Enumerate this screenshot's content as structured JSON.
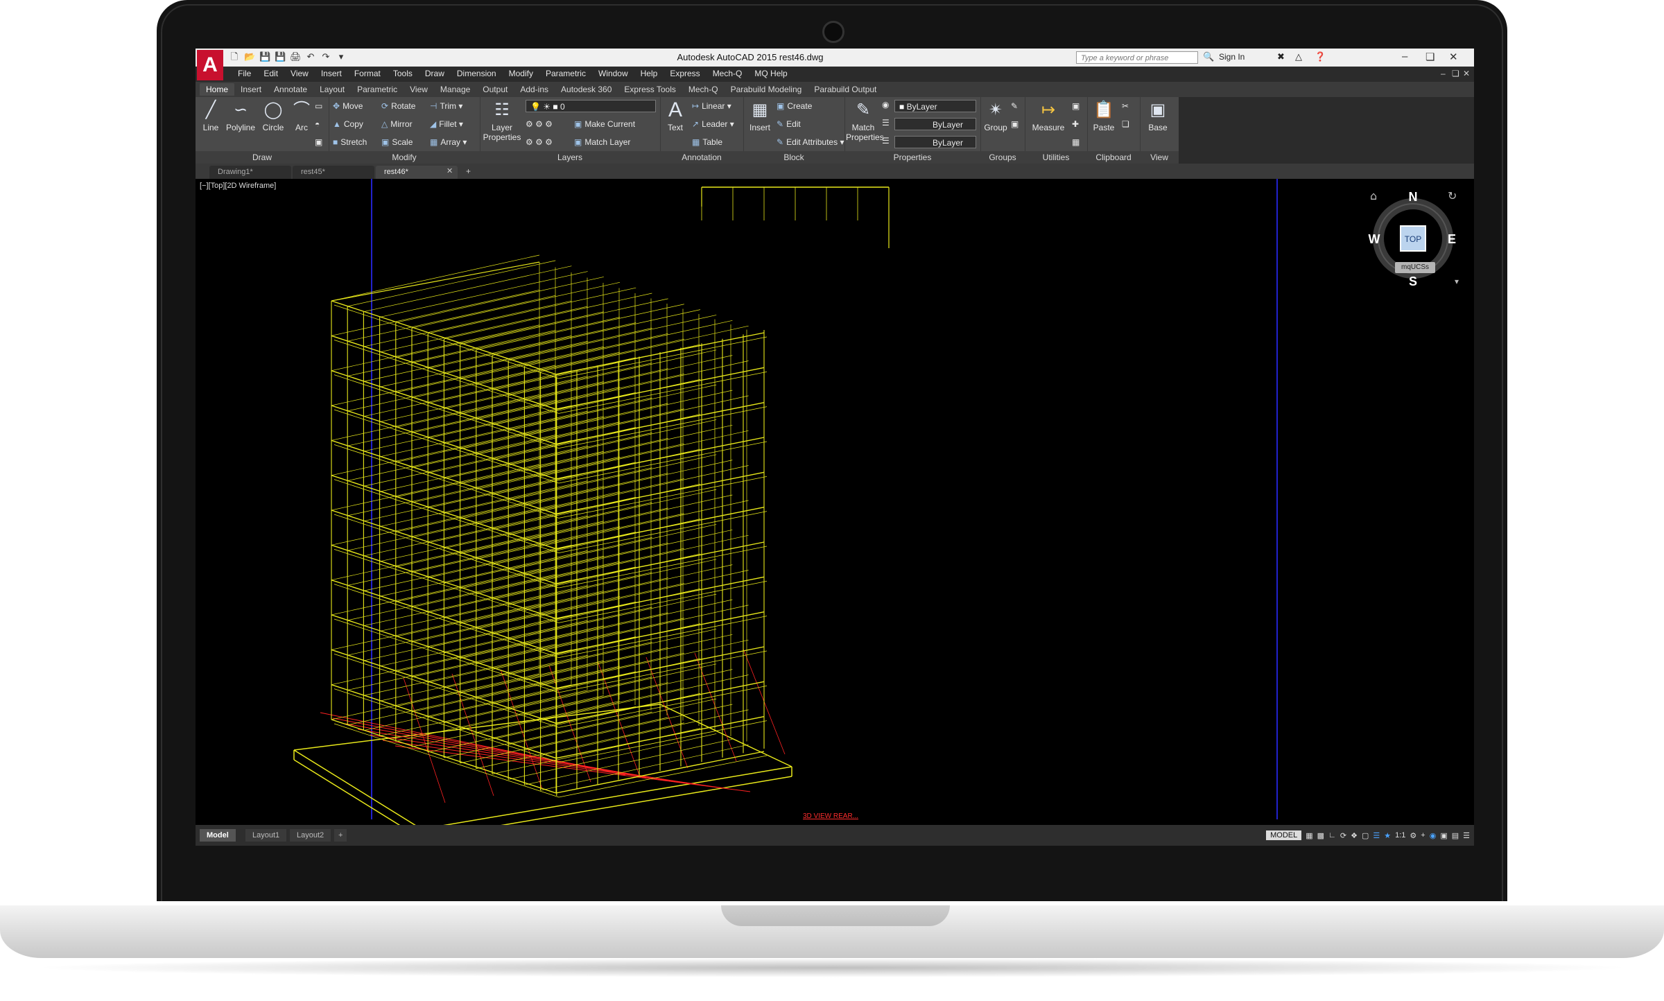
{
  "window": {
    "title": "Autodesk AutoCAD 2015   rest46.dwg",
    "search_placeholder": "Type a keyword or phrase",
    "sign_in": "Sign In",
    "app_logo": "A"
  },
  "menu": [
    "File",
    "Edit",
    "View",
    "Insert",
    "Format",
    "Tools",
    "Draw",
    "Dimension",
    "Modify",
    "Parametric",
    "Window",
    "Help",
    "Express",
    "Mech-Q",
    "MQ Help"
  ],
  "ribbon_tabs": [
    "Home",
    "Insert",
    "Annotate",
    "Layout",
    "Parametric",
    "View",
    "Manage",
    "Output",
    "Add-ins",
    "Autodesk 360",
    "Express Tools",
    "Mech-Q",
    "Parabuild Modeling",
    "Parabuild Output"
  ],
  "ribbon": {
    "draw": {
      "title": "Draw",
      "line": "Line",
      "polyline": "Polyline",
      "circle": "Circle",
      "arc": "Arc"
    },
    "modify": {
      "title": "Modify",
      "move": "Move",
      "copy": "Copy",
      "stretch": "Stretch",
      "rotate": "Rotate",
      "mirror": "Mirror",
      "scale": "Scale",
      "trim": "Trim",
      "fillet": "Fillet",
      "array": "Array"
    },
    "layers": {
      "title": "Layers",
      "layer_properties_1": "Layer",
      "layer_properties_2": "Properties",
      "current_layer": "0",
      "make_current": "Make Current",
      "match_layer": "Match Layer"
    },
    "annotation": {
      "title": "Annotation",
      "text": "Text",
      "linear": "Linear",
      "leader": "Leader",
      "table": "Table"
    },
    "block": {
      "title": "Block",
      "insert": "Insert",
      "create": "Create",
      "edit": "Edit",
      "edit_attributes": "Edit Attributes"
    },
    "properties": {
      "title": "Properties",
      "match_1": "Match",
      "match_2": "Properties",
      "color": "ByLayer",
      "linetype": "ByLayer",
      "lineweight": "ByLayer"
    },
    "groups": {
      "title": "Groups",
      "group": "Group"
    },
    "utilities": {
      "title": "Utilities",
      "measure": "Measure"
    },
    "clipboard": {
      "title": "Clipboard",
      "paste": "Paste"
    },
    "view": {
      "title": "View",
      "base": "Base"
    }
  },
  "doc_tabs": [
    "Drawing1*",
    "rest45*",
    "rest46*"
  ],
  "viewport": {
    "label": "[−][Top][2D Wireframe]",
    "footer_label": "3D VIEW REAR...",
    "ucs_button": "mqUCSs",
    "compass": {
      "n": "N",
      "s": "S",
      "e": "E",
      "w": "W",
      "face": "TOP"
    }
  },
  "layout_tabs": [
    "Model",
    "Layout1",
    "Layout2"
  ],
  "status": {
    "model": "MODEL",
    "scale": "1:1"
  },
  "colors": {
    "structure": "#e8e81a",
    "grid": "#ff2222",
    "background": "#000000",
    "ribbon": "#4a4a4a"
  }
}
